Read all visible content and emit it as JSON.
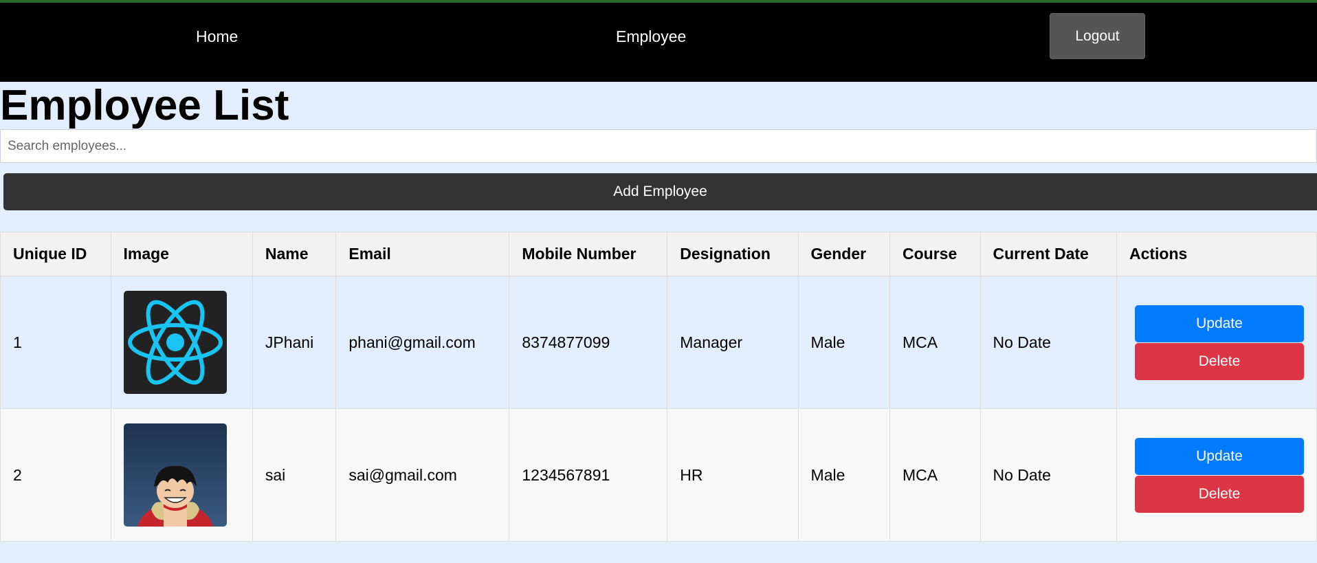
{
  "nav": {
    "home": "Home",
    "employee": "Employee",
    "logout": "Logout"
  },
  "page": {
    "title": "Employee List",
    "search_placeholder": "Search employees...",
    "add_button": "Add Employee"
  },
  "colors": {
    "navbar": "#000000",
    "update_button": "#007bff",
    "delete_button": "#dc3545",
    "add_button": "#333333",
    "page_background": "#e3eefd"
  },
  "table": {
    "headers": [
      "Unique ID",
      "Image",
      "Name",
      "Email",
      "Mobile Number",
      "Designation",
      "Gender",
      "Course",
      "Current Date",
      "Actions"
    ],
    "rows": [
      {
        "id": "1",
        "image": "react-logo-icon",
        "name": "JPhani",
        "email": "phani@gmail.com",
        "mobile": "8374877099",
        "designation": "Manager",
        "gender": "Male",
        "course": "MCA",
        "date": "No Date",
        "update": "Update",
        "delete": "Delete"
      },
      {
        "id": "2",
        "image": "anime-avatar-image",
        "name": "sai",
        "email": "sai@gmail.com",
        "mobile": "1234567891",
        "designation": "HR",
        "gender": "Male",
        "course": "MCA",
        "date": "No Date",
        "update": "Update",
        "delete": "Delete"
      }
    ]
  }
}
